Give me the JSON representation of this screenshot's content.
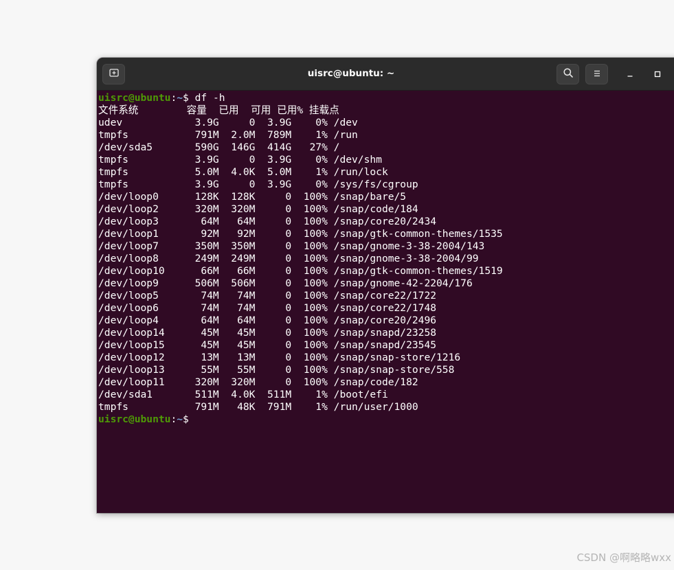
{
  "window": {
    "title": "uisrc@ubuntu: ~",
    "colors": {
      "terminal_bg": "#300a24",
      "titlebar_bg": "#2b2b2b",
      "prompt_user": "#4e9a06",
      "prompt_path": "#729fcf",
      "text": "#ffffff"
    },
    "icons": {
      "new_tab": "new-tab-icon",
      "search": "search-icon",
      "menu": "hamburger-menu-icon",
      "minimize": "minimize-icon",
      "maximize": "maximize-icon"
    }
  },
  "prompt": {
    "user_host": "uisrc@ubuntu",
    "colon": ":",
    "path": "~",
    "dollar": "$"
  },
  "command": " df -h",
  "output": [
    "文件系统        容量  已用  可用 已用% 挂载点",
    "udev            3.9G     0  3.9G    0% /dev",
    "tmpfs           791M  2.0M  789M    1% /run",
    "/dev/sda5       590G  146G  414G   27% /",
    "tmpfs           3.9G     0  3.9G    0% /dev/shm",
    "tmpfs           5.0M  4.0K  5.0M    1% /run/lock",
    "tmpfs           3.9G     0  3.9G    0% /sys/fs/cgroup",
    "/dev/loop0      128K  128K     0  100% /snap/bare/5",
    "/dev/loop2      320M  320M     0  100% /snap/code/184",
    "/dev/loop3       64M   64M     0  100% /snap/core20/2434",
    "/dev/loop1       92M   92M     0  100% /snap/gtk-common-themes/1535",
    "/dev/loop7      350M  350M     0  100% /snap/gnome-3-38-2004/143",
    "/dev/loop8      249M  249M     0  100% /snap/gnome-3-38-2004/99",
    "/dev/loop10      66M   66M     0  100% /snap/gtk-common-themes/1519",
    "/dev/loop9      506M  506M     0  100% /snap/gnome-42-2204/176",
    "/dev/loop5       74M   74M     0  100% /snap/core22/1722",
    "/dev/loop6       74M   74M     0  100% /snap/core22/1748",
    "/dev/loop4       64M   64M     0  100% /snap/core20/2496",
    "/dev/loop14      45M   45M     0  100% /snap/snapd/23258",
    "/dev/loop15      45M   45M     0  100% /snap/snapd/23545",
    "/dev/loop12      13M   13M     0  100% /snap/snap-store/1216",
    "/dev/loop13      55M   55M     0  100% /snap/snap-store/558",
    "/dev/loop11     320M  320M     0  100% /snap/code/182",
    "/dev/sda1       511M  4.0K  511M    1% /boot/efi",
    "tmpfs           791M   48K  791M    1% /run/user/1000"
  ],
  "watermark": "CSDN @啊略略wxx"
}
